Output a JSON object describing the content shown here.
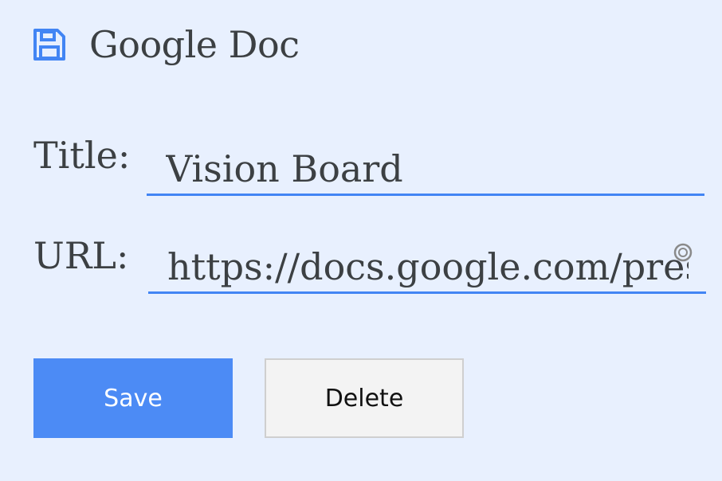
{
  "header": {
    "icon": "save-icon",
    "title": "Google Doc"
  },
  "form": {
    "title_label": "Title:",
    "title_value": "Vision Board",
    "url_label": "URL:",
    "url_value": "https://docs.google.com/prese",
    "clear_icon": "clear-icon"
  },
  "actions": {
    "save_label": "Save",
    "delete_label": "Delete"
  },
  "colors": {
    "background": "#e8f0fe",
    "accent": "#4285f4",
    "save_button": "#4c8bf5",
    "delete_button": "#f3f3f3"
  }
}
